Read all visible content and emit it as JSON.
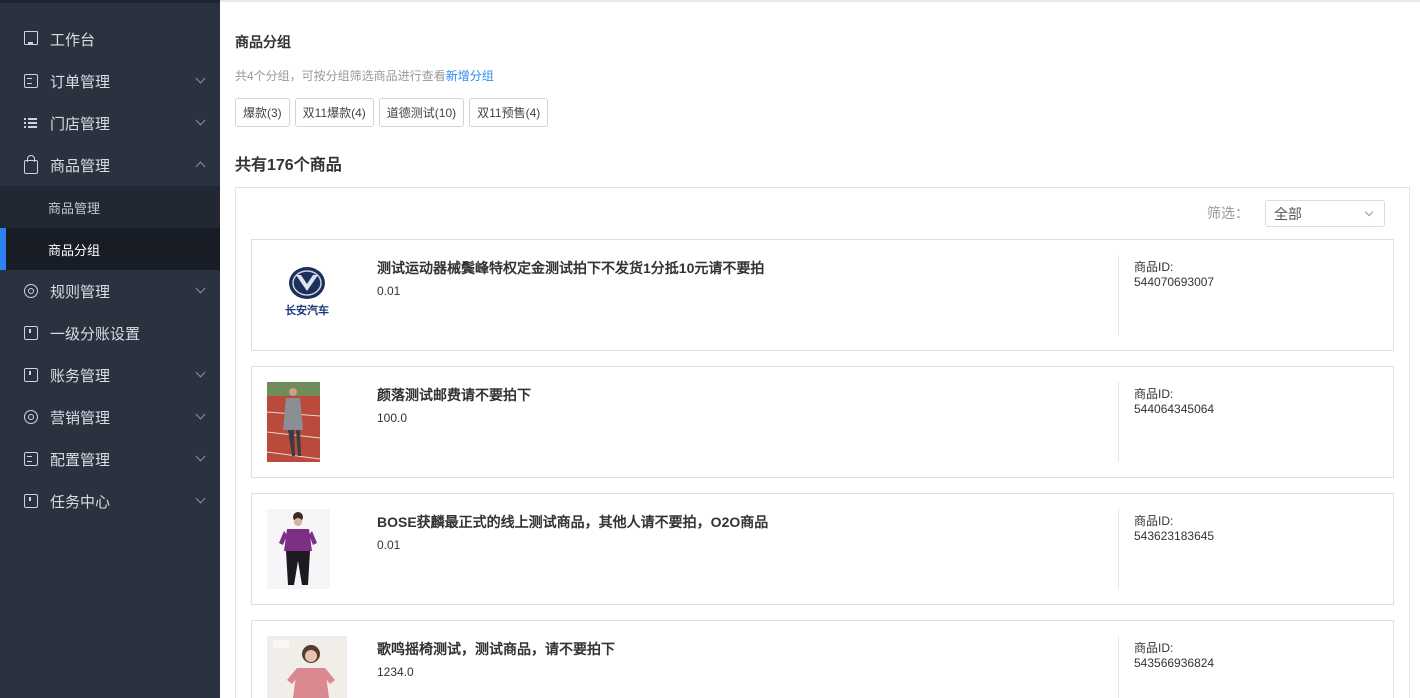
{
  "sidebar": {
    "items": [
      {
        "label": "工作台",
        "icon": "monitor-icon"
      },
      {
        "label": "订单管理",
        "icon": "document-icon"
      },
      {
        "label": "门店管理",
        "icon": "list-icon"
      },
      {
        "label": "商品管理",
        "icon": "bag-icon"
      },
      {
        "label": "规则管理",
        "icon": "gear-icon"
      },
      {
        "label": "一级分账设置",
        "icon": "book-icon"
      },
      {
        "label": "账务管理",
        "icon": "book-icon"
      },
      {
        "label": "营销管理",
        "icon": "gear-icon"
      },
      {
        "label": "配置管理",
        "icon": "document-icon"
      },
      {
        "label": "任务中心",
        "icon": "book-icon"
      }
    ],
    "submenu": [
      {
        "label": "商品管理"
      },
      {
        "label": "商品分组"
      }
    ]
  },
  "main": {
    "title": "商品分组",
    "summary_text": "共4个分组，可按分组筛选商品进行查看",
    "add_group_link": "新增分组",
    "groups": [
      "爆款(3)",
      "双11爆款(4)",
      "道德测试(10)",
      "双11预售(4)"
    ],
    "total": "共有176个商品",
    "filter_label": "筛选：",
    "filter_value": "全部",
    "id_label": "商品ID:",
    "products": [
      {
        "name": "测试运动器械鬓峰特权定金测试拍下不发货1分抵10元请不要拍",
        "price": "0.01",
        "id": "544070693007",
        "logo_text": "长安汽车"
      },
      {
        "name": "颜落测试邮费请不要拍下",
        "price": "100.0",
        "id": "544064345064"
      },
      {
        "name": "BOSE获麟最正式的线上测试商品，其他人请不要拍，O2O商品",
        "price": "0.01",
        "id": "543623183645"
      },
      {
        "name": "歌鸣摇椅测试，测试商品，请不要拍下",
        "price": "1234.0",
        "id": "543566936824"
      }
    ]
  },
  "colors": {
    "sidebar_bg": "#2b323f",
    "submenu_bg": "#222833",
    "active_indicator": "#2f7ff5",
    "link": "#2d8cf0"
  }
}
